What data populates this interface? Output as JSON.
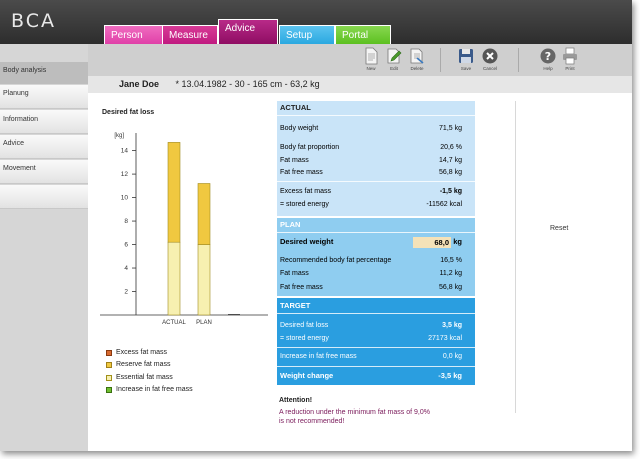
{
  "app": {
    "logo": "BCA"
  },
  "tabs": [
    {
      "label": "Person",
      "color": "#e040a8",
      "active": false
    },
    {
      "label": "Measure",
      "color": "#c01a80",
      "active": false
    },
    {
      "label": "Advice",
      "color": "#a01070",
      "active": true
    },
    {
      "label": "Setup",
      "color": "#2aa8e0",
      "active": false
    },
    {
      "label": "Portal",
      "color": "#5cc020",
      "active": false
    }
  ],
  "sidebar": {
    "items": [
      {
        "label": "Body analysis",
        "active": true
      },
      {
        "label": "Planung",
        "active": false
      },
      {
        "label": "Information",
        "active": false
      },
      {
        "label": "Advice",
        "active": false
      },
      {
        "label": "Movement",
        "active": false
      }
    ]
  },
  "toolbar": {
    "new": "New",
    "edit": "Edit",
    "delete": "Delete",
    "save": "Save",
    "cancel": "Cancel",
    "help": "Help",
    "print": "Print"
  },
  "patient": {
    "name": "Jane Doe",
    "details": "* 13.04.1982  -  30  -  165 cm  -  63,2 kg"
  },
  "chart_data": {
    "type": "bar",
    "title": "Desired fat loss",
    "ylabel": "[kg]",
    "categories": [
      "ACTUAL",
      "PLAN"
    ],
    "ylim": [
      0,
      15.5
    ],
    "yticks": [
      2,
      4,
      6,
      8,
      10,
      12,
      14
    ],
    "series": [
      {
        "name": "Essential fat mass",
        "color": "#f7f0b0",
        "values": [
          6.2,
          6.0
        ]
      },
      {
        "name": "Reserve fat mass",
        "color": "#f0c840",
        "values": [
          8.5,
          5.2
        ]
      },
      {
        "name": "Excess fat mass",
        "color": "#d86a30",
        "values": [
          0,
          0
        ]
      },
      {
        "name": "Increase in fat free mass",
        "color": "#70c030",
        "values": [
          0,
          0
        ]
      }
    ],
    "legend": [
      {
        "label": "Excess fat mass",
        "color": "#d86a30"
      },
      {
        "label": "Reserve fat mass",
        "color": "#f0c840"
      },
      {
        "label": "Essential fat mass",
        "color": "#f7f0b0"
      },
      {
        "label": "Increase in fat free mass",
        "color": "#70c030"
      }
    ]
  },
  "actual": {
    "title": "ACTUAL",
    "body_weight": {
      "label": "Body weight",
      "value": "71,5 kg"
    },
    "body_fat_proportion": {
      "label": "Body fat proportion",
      "value": "20,6  %"
    },
    "fat_mass": {
      "label": "Fat mass",
      "value": "14,7 kg"
    },
    "fat_free_mass": {
      "label": "Fat free mass",
      "value": "56,8 kg"
    },
    "excess_fat_mass": {
      "label": "Excess fat mass",
      "value": "-1,5 kg"
    },
    "stored_energy": {
      "label": "= stored energy",
      "value": "-11562 kcal"
    }
  },
  "plan": {
    "title": "PLAN",
    "desired_weight": {
      "label": "Desired weight",
      "value": "68,0",
      "unit": "kg"
    },
    "recommended_bf": {
      "label": "Recommended body fat percentage",
      "value": "16,5  %"
    },
    "fat_mass": {
      "label": "Fat mass",
      "value": "11,2 kg"
    },
    "fat_free_mass": {
      "label": "Fat free mass",
      "value": "56,8 kg"
    }
  },
  "target": {
    "title": "TARGET",
    "desired_fat_loss": {
      "label": "Desired fat loss",
      "value": "3,5 kg"
    },
    "stored_energy": {
      "label": "= stored energy",
      "value": "27173 kcal"
    },
    "increase_ffm": {
      "label": "Increase in fat free mass",
      "value": "0,0 kg"
    },
    "weight_change": {
      "label": "Weight change",
      "value": "-3,5 kg"
    }
  },
  "attention": {
    "title": "Attention!",
    "line1": "A reduction under the minimum fat mass of 9,0%",
    "line2": "is not recommended!"
  },
  "reset": "Reset"
}
